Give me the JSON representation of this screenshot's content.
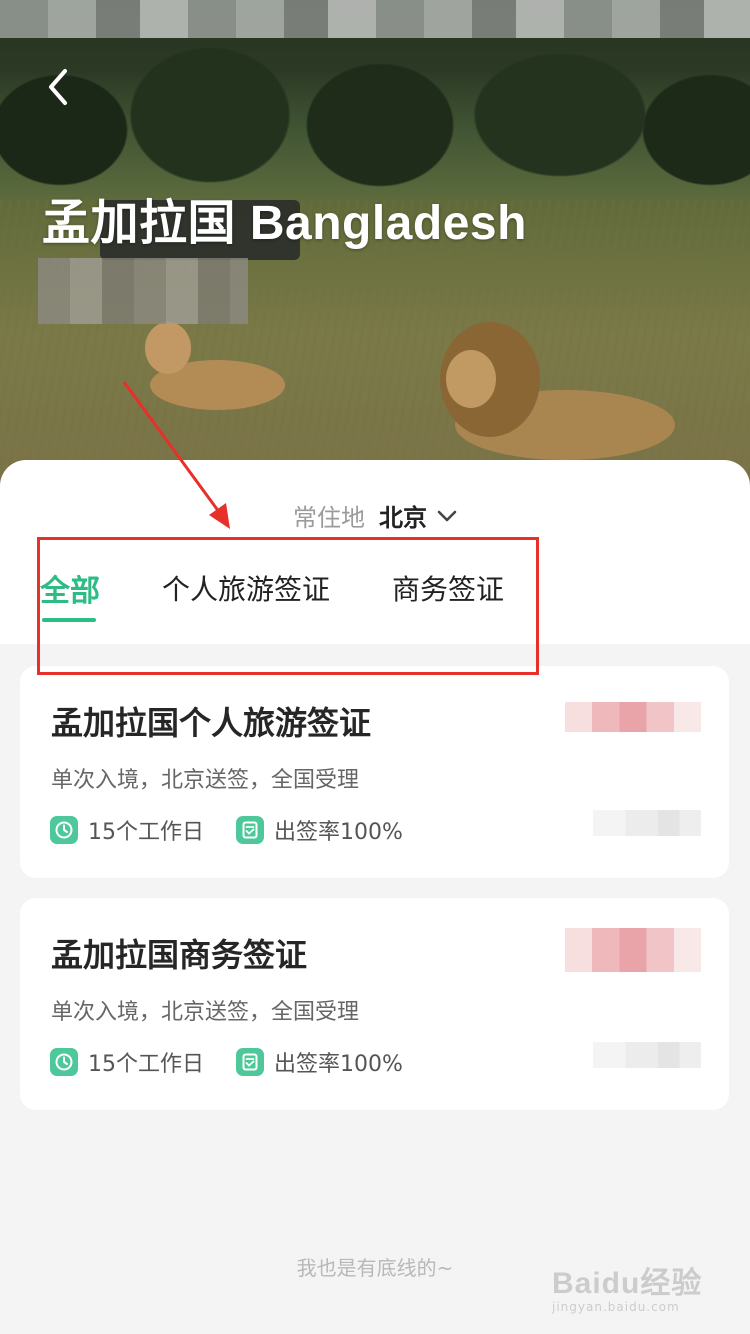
{
  "hero": {
    "title": "孟加拉国 Bangladesh",
    "back_icon": "chevron-left-icon"
  },
  "residence": {
    "label": "常住地",
    "city": "北京",
    "dropdown_icon": "chevron-down-icon"
  },
  "tabs": [
    {
      "label": "全部",
      "active": true
    },
    {
      "label": "个人旅游签证",
      "active": false
    },
    {
      "label": "商务签证",
      "active": false
    }
  ],
  "products": [
    {
      "title": "孟加拉国个人旅游签证",
      "description": "单次入境，北京送签，全国受理",
      "duration": "15个工作日",
      "approval_rate": "出签率100%"
    },
    {
      "title": "孟加拉国商务签证",
      "description": "单次入境，北京送签，全国受理",
      "duration": "15个工作日",
      "approval_rate": "出签率100%"
    }
  ],
  "footer": {
    "note": "我也是有底线的~"
  },
  "watermark": {
    "brand": "Baidu经验",
    "url": "jingyan.baidu.com"
  },
  "colors": {
    "accent": "#2ebc85",
    "icon_bg": "#4ec89a",
    "annotation": "#e8302a",
    "page_bg": "#f4f4f4"
  }
}
